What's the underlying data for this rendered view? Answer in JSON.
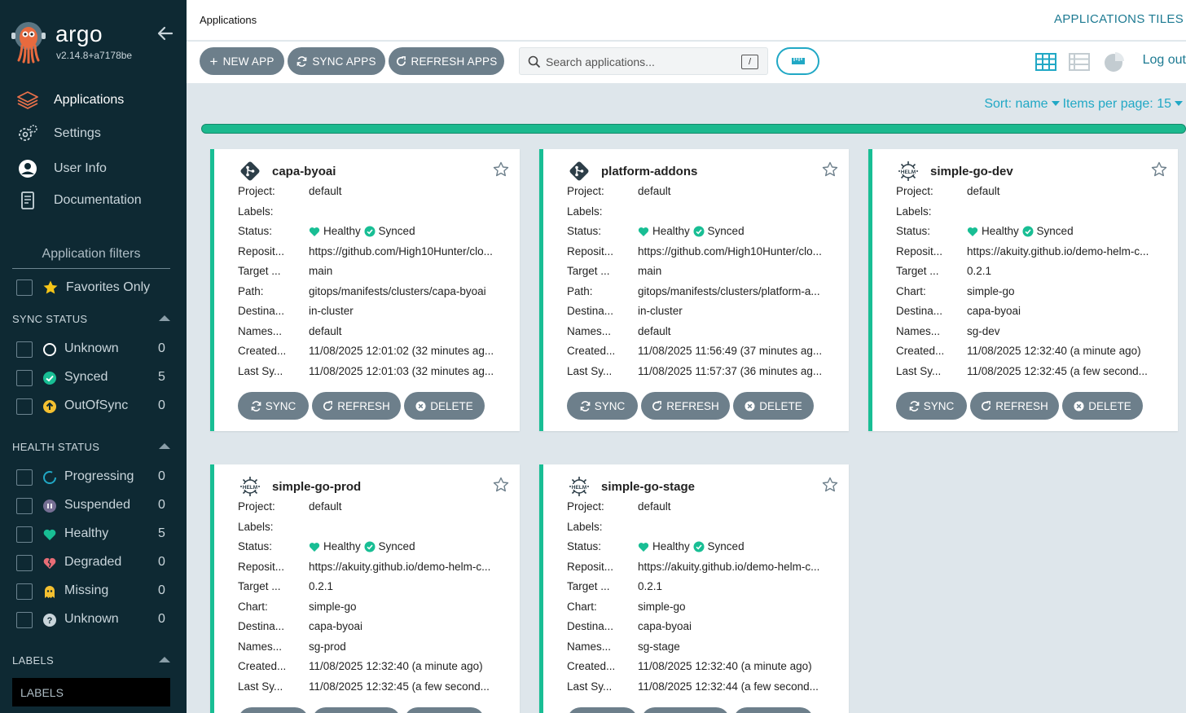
{
  "sidebar": {
    "brand": "argo",
    "version": "v2.14.8+a7178be",
    "nav": [
      {
        "label": "Applications"
      },
      {
        "label": "Settings"
      },
      {
        "label": "User Info"
      },
      {
        "label": "Documentation"
      }
    ],
    "filters_title": "Application filters",
    "favorites_label": "Favorites Only",
    "sync_status": {
      "title": "SYNC STATUS",
      "items": [
        {
          "label": "Unknown",
          "count": "0"
        },
        {
          "label": "Synced",
          "count": "5"
        },
        {
          "label": "OutOfSync",
          "count": "0"
        }
      ]
    },
    "health_status": {
      "title": "HEALTH STATUS",
      "items": [
        {
          "label": "Progressing",
          "count": "0"
        },
        {
          "label": "Suspended",
          "count": "0"
        },
        {
          "label": "Healthy",
          "count": "5"
        },
        {
          "label": "Degraded",
          "count": "0"
        },
        {
          "label": "Missing",
          "count": "0"
        },
        {
          "label": "Unknown",
          "count": "0"
        }
      ]
    },
    "labels": {
      "title": "LABELS",
      "placeholder": "LABELS"
    }
  },
  "topbar": {
    "breadcrumb": "Applications",
    "title": "APPLICATIONS TILES"
  },
  "toolbar": {
    "new_app": "NEW APP",
    "sync_apps": "SYNC APPS",
    "refresh_apps": "REFRESH APPS",
    "search_placeholder": "Search applications...",
    "search_shortcut": "/",
    "logout": "Log out"
  },
  "sort": {
    "sort_label": "Sort: name",
    "per_page_label": "Items per page: 15"
  },
  "colors": {
    "accent": "#21a8c5",
    "healthy": "#18be94",
    "sidebar_bg": "#0e2933",
    "button_bg": "#6d7f8b"
  },
  "card_buttons": {
    "sync": "SYNC",
    "refresh": "REFRESH",
    "delete": "DELETE"
  },
  "apps": [
    {
      "name": "capa-byoai",
      "icon": "git-icon",
      "fields": [
        {
          "k": "Project:",
          "v": "default"
        },
        {
          "k": "Labels:",
          "v": ""
        },
        {
          "k": "Status:",
          "health": "Healthy",
          "sync": "Synced"
        },
        {
          "k": "Reposit...",
          "v": "https://github.com/High10Hunter/clo..."
        },
        {
          "k": "Target ...",
          "v": "main"
        },
        {
          "k": "Path:",
          "v": "gitops/manifests/clusters/capa-byoai"
        },
        {
          "k": "Destina...",
          "v": "in-cluster"
        },
        {
          "k": "Names...",
          "v": "default"
        },
        {
          "k": "Created...",
          "v": "11/08/2025 12:01:02  (32 minutes ag..."
        },
        {
          "k": "Last Sy...",
          "v": "11/08/2025 12:01:03  (32 minutes ag..."
        }
      ]
    },
    {
      "name": "platform-addons",
      "icon": "git-icon",
      "fields": [
        {
          "k": "Project:",
          "v": "default"
        },
        {
          "k": "Labels:",
          "v": ""
        },
        {
          "k": "Status:",
          "health": "Healthy",
          "sync": "Synced"
        },
        {
          "k": "Reposit...",
          "v": "https://github.com/High10Hunter/clo..."
        },
        {
          "k": "Target ...",
          "v": "main"
        },
        {
          "k": "Path:",
          "v": "gitops/manifests/clusters/platform-a..."
        },
        {
          "k": "Destina...",
          "v": "in-cluster"
        },
        {
          "k": "Names...",
          "v": "default"
        },
        {
          "k": "Created...",
          "v": "11/08/2025 11:56:49  (37 minutes ag..."
        },
        {
          "k": "Last Sy...",
          "v": "11/08/2025 11:57:37  (36 minutes ag..."
        }
      ]
    },
    {
      "name": "simple-go-dev",
      "icon": "helm-icon",
      "fields": [
        {
          "k": "Project:",
          "v": "default"
        },
        {
          "k": "Labels:",
          "v": ""
        },
        {
          "k": "Status:",
          "health": "Healthy",
          "sync": "Synced"
        },
        {
          "k": "Reposit...",
          "v": "https://akuity.github.io/demo-helm-c..."
        },
        {
          "k": "Target ...",
          "v": "0.2.1"
        },
        {
          "k": "Chart:",
          "v": "simple-go"
        },
        {
          "k": "Destina...",
          "v": "capa-byoai"
        },
        {
          "k": "Names...",
          "v": "sg-dev"
        },
        {
          "k": "Created...",
          "v": "11/08/2025 12:32:40  (a minute ago)"
        },
        {
          "k": "Last Sy...",
          "v": "11/08/2025 12:32:45  (a few second..."
        }
      ]
    },
    {
      "name": "simple-go-prod",
      "icon": "helm-icon",
      "fields": [
        {
          "k": "Project:",
          "v": "default"
        },
        {
          "k": "Labels:",
          "v": ""
        },
        {
          "k": "Status:",
          "health": "Healthy",
          "sync": "Synced"
        },
        {
          "k": "Reposit...",
          "v": "https://akuity.github.io/demo-helm-c..."
        },
        {
          "k": "Target ...",
          "v": "0.2.1"
        },
        {
          "k": "Chart:",
          "v": "simple-go"
        },
        {
          "k": "Destina...",
          "v": "capa-byoai"
        },
        {
          "k": "Names...",
          "v": "sg-prod"
        },
        {
          "k": "Created...",
          "v": "11/08/2025 12:32:40  (a minute ago)"
        },
        {
          "k": "Last Sy...",
          "v": "11/08/2025 12:32:45  (a few second..."
        }
      ]
    },
    {
      "name": "simple-go-stage",
      "icon": "helm-icon",
      "fields": [
        {
          "k": "Project:",
          "v": "default"
        },
        {
          "k": "Labels:",
          "v": ""
        },
        {
          "k": "Status:",
          "health": "Healthy",
          "sync": "Synced"
        },
        {
          "k": "Reposit...",
          "v": "https://akuity.github.io/demo-helm-c..."
        },
        {
          "k": "Target ...",
          "v": "0.2.1"
        },
        {
          "k": "Chart:",
          "v": "simple-go"
        },
        {
          "k": "Destina...",
          "v": "capa-byoai"
        },
        {
          "k": "Names...",
          "v": "sg-stage"
        },
        {
          "k": "Created...",
          "v": "11/08/2025 12:32:40  (a minute ago)"
        },
        {
          "k": "Last Sy...",
          "v": "11/08/2025 12:32:44  (a few second..."
        }
      ]
    }
  ]
}
